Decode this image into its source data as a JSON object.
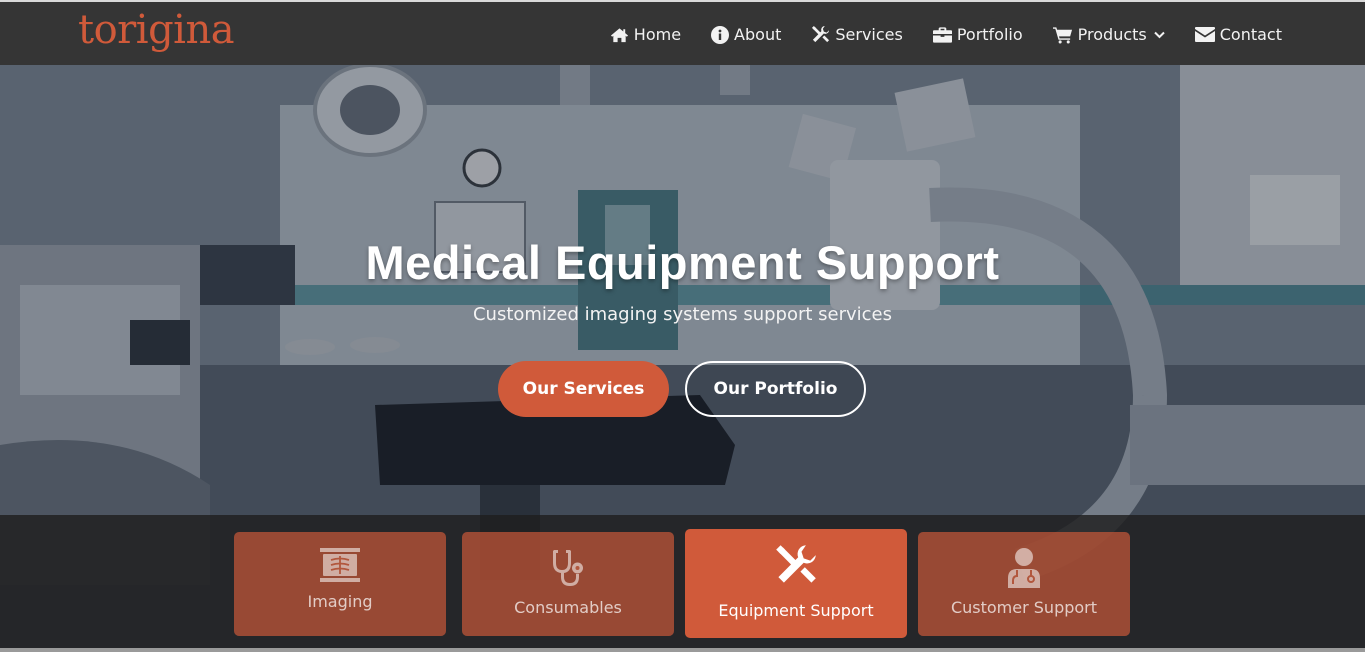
{
  "brand": {
    "logo": "torigina",
    "accent": "#d05a3a"
  },
  "nav": {
    "items": [
      {
        "label": "Home",
        "icon": "home-icon"
      },
      {
        "label": "About",
        "icon": "info-icon"
      },
      {
        "label": "Services",
        "icon": "tools-icon"
      },
      {
        "label": "Portfolio",
        "icon": "briefcase-icon"
      },
      {
        "label": "Products",
        "icon": "cart-icon",
        "dropdown": true
      },
      {
        "label": "Contact",
        "icon": "envelope-icon"
      }
    ]
  },
  "hero": {
    "title": "Medical Equipment Support",
    "subtitle": "Customized imaging systems support services",
    "primary_button": "Our Services",
    "secondary_button": "Our Portfolio"
  },
  "services": [
    {
      "label": "Imaging",
      "icon": "xray-icon",
      "active": false
    },
    {
      "label": "Consumables",
      "icon": "stethoscope-icon",
      "active": false
    },
    {
      "label": "Equipment Support",
      "icon": "tools-icon",
      "active": true
    },
    {
      "label": "Customer Support",
      "icon": "doctor-icon",
      "active": false
    }
  ]
}
